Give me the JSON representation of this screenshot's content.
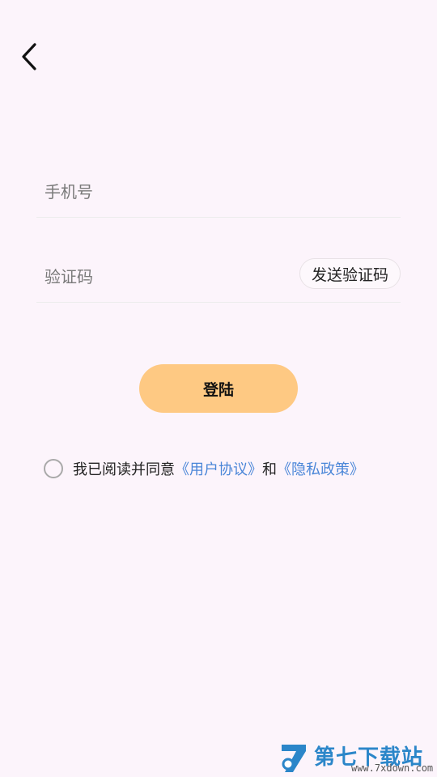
{
  "phone": {
    "placeholder": "手机号",
    "value": ""
  },
  "code": {
    "placeholder": "验证码",
    "value": "",
    "send_label": "发送验证码"
  },
  "login_label": "登陆",
  "agreement": {
    "checked": false,
    "prefix": "我已阅读并同意",
    "user_agreement": "《用户协议》",
    "and": "和",
    "privacy_policy": "《隐私政策》"
  },
  "watermark": {
    "title": "第七下载站",
    "url": "www.7xdown.com"
  },
  "colors": {
    "background": "#fcf4fb",
    "login_button": "#fec983",
    "link": "#4a86d8",
    "watermark": "#2b86c9"
  },
  "icons": {
    "back": "chevron-left-icon",
    "checkbox": "radio-circle-icon"
  }
}
